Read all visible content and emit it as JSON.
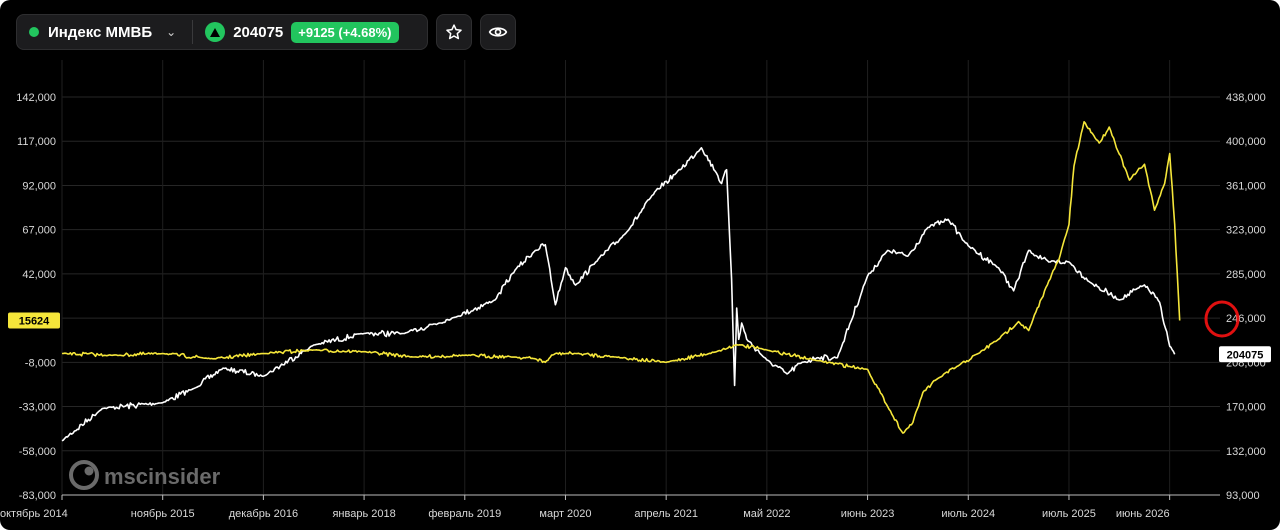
{
  "header": {
    "ticker_name": "Индекс ММВБ",
    "price": "204075",
    "change": "+9125 (+4.68%)",
    "favorite_icon": "star-icon",
    "watch_icon": "eye-icon",
    "expand_icon": "chevron-down-icon",
    "up_icon": "triangle-up-icon"
  },
  "watermark": "mscinsider",
  "colors": {
    "background": "#000000",
    "white_series": "#ffffff",
    "yellow_series": "#f5e63a",
    "accent_green": "#22c55e",
    "marker_red": "#e01010"
  },
  "chart_data": {
    "type": "line",
    "grid": true,
    "x_tick_labels": [
      "октябрь 2014",
      "ноябрь 2015",
      "декабрь 2016",
      "январь 2018",
      "февраль 2019",
      "март 2020",
      "апрель 2021",
      "май 2022",
      "июнь 2023",
      "июль 2024",
      "июль 2025",
      "июнь 2026"
    ],
    "left_axis": {
      "tick_labels": [
        "142,000",
        "117,000",
        "92,000",
        "67,000",
        "42,000",
        "17,000",
        "-8,000",
        "-33,000",
        "-58,000",
        "-83,000"
      ],
      "ylim": [
        -83000,
        142000
      ]
    },
    "right_axis": {
      "tick_labels": [
        "438,000",
        "400,000",
        "361,000",
        "323,000",
        "285,000",
        "246,000",
        "208,000",
        "170,000",
        "132,000",
        "93,000"
      ],
      "ylim": [
        93000,
        438000
      ]
    },
    "yellow_last_label": "15624",
    "white_last_label": "204075",
    "series": [
      {
        "color": "#ffffff",
        "axis": "right",
        "x": [
          0,
          0.4,
          1,
          1.3,
          1.6,
          2,
          2.5,
          3,
          3.4,
          3.9,
          4.3,
          4.5,
          4.7,
          4.8,
          4.9,
          5.0,
          5.1,
          5.3,
          5.6,
          5.9,
          6.1,
          6.35,
          6.5,
          6.55,
          6.6,
          6.65,
          6.68,
          6.7,
          6.72,
          6.75,
          6.8,
          7.0,
          7.2,
          7.35,
          7.5,
          7.7,
          8.0,
          8.2,
          8.4,
          8.6,
          8.8,
          9.0,
          9.3,
          9.45,
          9.6,
          9.8,
          10.0,
          10.2,
          10.5,
          10.75,
          10.9,
          11.0,
          11.05
        ],
        "y": [
          140000,
          168000,
          173000,
          185000,
          203000,
          196000,
          223000,
          233000,
          233000,
          247000,
          262000,
          288000,
          305000,
          310000,
          258000,
          290000,
          275000,
          295000,
          320000,
          357000,
          372000,
          394000,
          372000,
          363000,
          375000,
          280000,
          188000,
          255000,
          228000,
          242000,
          228000,
          210000,
          198000,
          208000,
          212000,
          212000,
          283000,
          305000,
          300000,
          325000,
          332000,
          309000,
          290000,
          270000,
          305000,
          295000,
          295000,
          278000,
          262000,
          275000,
          260000,
          222000,
          215000
        ]
      },
      {
        "color": "#f5e63a",
        "axis": "left",
        "x": [
          0,
          0.5,
          1,
          1.5,
          2,
          2.5,
          3,
          3.5,
          4,
          4.5,
          4.7,
          4.8,
          4.85,
          4.9,
          5.1,
          5.5,
          6.0,
          6.5,
          6.7,
          7.0,
          7.5,
          8.0,
          8.2,
          8.35,
          8.45,
          8.55,
          8.7,
          8.9,
          9.1,
          9.3,
          9.5,
          9.6,
          9.8,
          9.9,
          10.0,
          10.05,
          10.15,
          10.3,
          10.4,
          10.6,
          10.75,
          10.85,
          10.95,
          11.0,
          11.05,
          11.1
        ],
        "y": [
          -3000,
          -4000,
          -3000,
          -6000,
          -3000,
          -1000,
          -2000,
          -5000,
          -4000,
          -5000,
          -6000,
          -8000,
          -5000,
          -3000,
          -3000,
          -5000,
          -8000,
          -2000,
          2000,
          -1000,
          -7000,
          -12000,
          -33000,
          -48000,
          -42000,
          -25000,
          -17000,
          -10000,
          -3000,
          5000,
          15000,
          10000,
          38000,
          50000,
          70000,
          103000,
          128000,
          116000,
          125000,
          95000,
          104000,
          78000,
          93000,
          110000,
          70000,
          15624
        ]
      }
    ]
  }
}
